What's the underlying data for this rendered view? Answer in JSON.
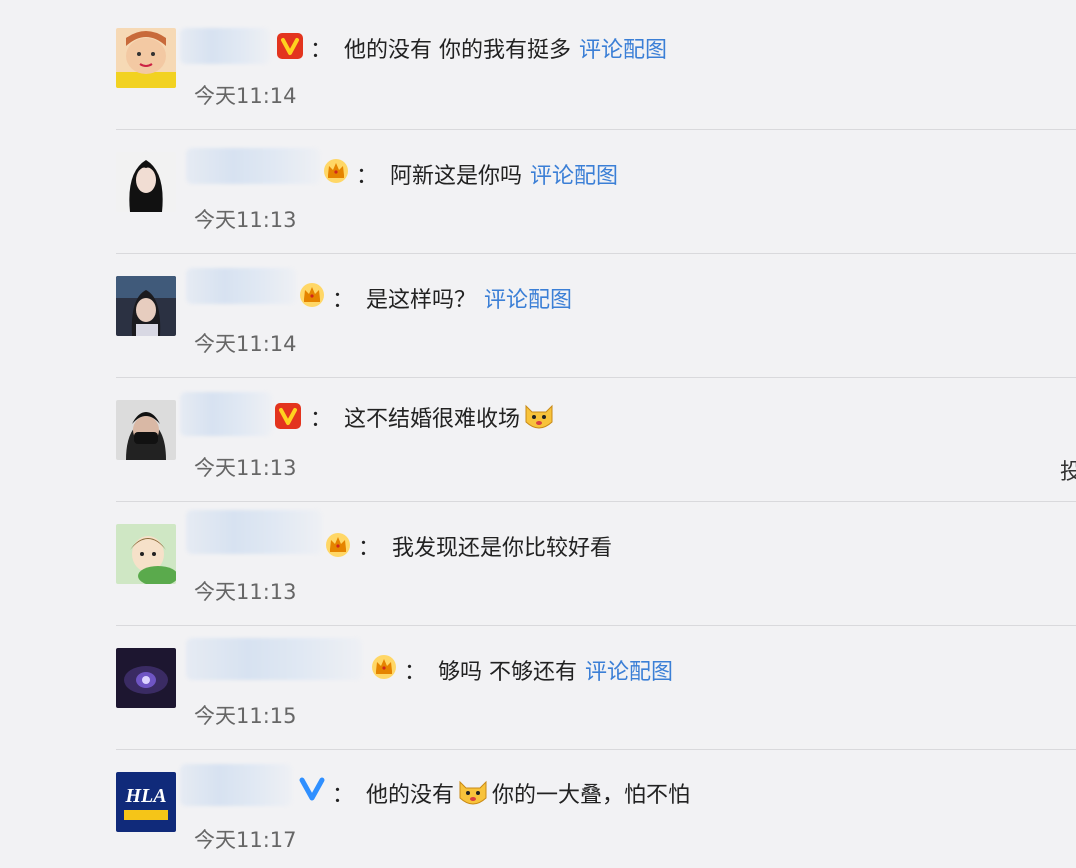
{
  "colors": {
    "background": "#f2f2f4",
    "link": "#3b7fd6",
    "text": "#222222",
    "time": "#666666",
    "vip_red": "#e3341e",
    "vip_blue": "#2f8fff",
    "crown": "#f5a400"
  },
  "comments": [
    {
      "badge": "vip-red-v-icon",
      "text": "他的没有 你的我有挺多",
      "link": "评论配图",
      "emoji": "",
      "text2": "",
      "time": "今天11:14"
    },
    {
      "badge": "crown-icon",
      "text": "阿新这是你吗",
      "link": "评论配图",
      "emoji": "",
      "text2": "",
      "time": "今天11:13"
    },
    {
      "badge": "crown-icon",
      "text": "是这样吗？",
      "link": "评论配图",
      "emoji": "",
      "text2": "",
      "time": "今天11:14"
    },
    {
      "badge": "vip-red-v-icon",
      "text": "这不结婚很难收场",
      "link": "",
      "emoji": "dog-face-emoji",
      "text2": "",
      "time": "今天11:13"
    },
    {
      "badge": "crown-icon",
      "text": "我发现还是你比较好看",
      "link": "",
      "emoji": "",
      "text2": "",
      "time": "今天11:13"
    },
    {
      "badge": "crown-icon",
      "text": "够吗 不够还有",
      "link": "评论配图",
      "emoji": "",
      "text2": "",
      "time": "今天11:15"
    },
    {
      "badge": "blue-v-icon",
      "text": "他的没有",
      "link": "",
      "emoji": "dog-face-emoji",
      "text2": "你的一大叠，怕不怕",
      "time": "今天11:17"
    }
  ],
  "colon": "：",
  "edge_char": "投",
  "avatar_logo_text": "HLA"
}
